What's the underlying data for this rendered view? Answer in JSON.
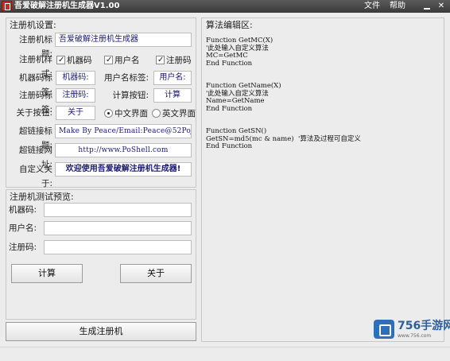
{
  "window": {
    "title": "吾爱破解注册机生成器V1.00",
    "menu": [
      "文件",
      "帮助"
    ],
    "minimize": "",
    "close": ""
  },
  "settings": {
    "group_title": "注册机设置:",
    "title_label": "注册机标题:",
    "title_value": "吾爱破解注册机生成器",
    "style_label": "注册机样式:",
    "style_options": [
      "机器码",
      "用户名",
      "注册码"
    ],
    "machine_label": "机器码标签:",
    "machine_value": "机器码:",
    "username_label": "用户名标签:",
    "username_value": "用户名:",
    "regcode_label": "注册码标签:",
    "regcode_value": "注册码:",
    "calc_label": "计算按钮:",
    "calc_value": "计算",
    "about_label": "关于按钮:",
    "about_value": "关于",
    "ui_options": [
      "中文界面",
      "英文界面"
    ],
    "link_title_label": "超链接标题:",
    "link_title_value": "Make By Peace/Email:Peace@52PoJie.Cn",
    "link_url_label": "超链接网址:",
    "link_url_value": "http://www.PoShell.com",
    "custom_about_label": "自定义关于:",
    "custom_about_value": "欢迎使用吾爱破解注册机生成器!"
  },
  "preview": {
    "group_title": "注册机测试预览:",
    "machine_label": "机器码:",
    "username_label": "用户名:",
    "regcode_label": "注册码:",
    "calc_button": "计算",
    "about_button": "关于"
  },
  "generate_button": "生成注册机",
  "editor": {
    "group_title": "算法编辑区:",
    "code": "Function GetMC(X)\n'此处输入自定义算法\nMC=GetMC\nEnd Function\n\n\nFunction GetName(X)\n'此处输入自定义算法\nName=GetName\nEnd Function\n\n\nFunction GetSN()\nGetSN=md5(mc & name)  '算法及过程可自定义\nEnd Function"
  },
  "watermark": {
    "text": "756手游网",
    "url": "www.756.com"
  }
}
